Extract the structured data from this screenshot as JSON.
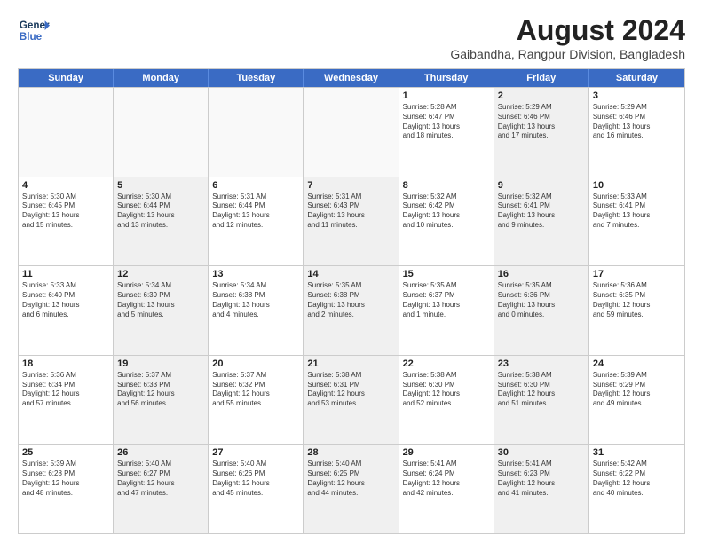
{
  "header": {
    "logo_line1": "General",
    "logo_line2": "Blue",
    "title": "August 2024",
    "subtitle": "Gaibandha, Rangpur Division, Bangladesh"
  },
  "days_of_week": [
    "Sunday",
    "Monday",
    "Tuesday",
    "Wednesday",
    "Thursday",
    "Friday",
    "Saturday"
  ],
  "weeks": [
    [
      {
        "day": "",
        "text": "",
        "shaded": false,
        "empty": true
      },
      {
        "day": "",
        "text": "",
        "shaded": false,
        "empty": true
      },
      {
        "day": "",
        "text": "",
        "shaded": false,
        "empty": true
      },
      {
        "day": "",
        "text": "",
        "shaded": false,
        "empty": true
      },
      {
        "day": "1",
        "text": "Sunrise: 5:28 AM\nSunset: 6:47 PM\nDaylight: 13 hours\nand 18 minutes.",
        "shaded": false,
        "empty": false
      },
      {
        "day": "2",
        "text": "Sunrise: 5:29 AM\nSunset: 6:46 PM\nDaylight: 13 hours\nand 17 minutes.",
        "shaded": true,
        "empty": false
      },
      {
        "day": "3",
        "text": "Sunrise: 5:29 AM\nSunset: 6:46 PM\nDaylight: 13 hours\nand 16 minutes.",
        "shaded": false,
        "empty": false
      }
    ],
    [
      {
        "day": "4",
        "text": "Sunrise: 5:30 AM\nSunset: 6:45 PM\nDaylight: 13 hours\nand 15 minutes.",
        "shaded": false,
        "empty": false
      },
      {
        "day": "5",
        "text": "Sunrise: 5:30 AM\nSunset: 6:44 PM\nDaylight: 13 hours\nand 13 minutes.",
        "shaded": true,
        "empty": false
      },
      {
        "day": "6",
        "text": "Sunrise: 5:31 AM\nSunset: 6:44 PM\nDaylight: 13 hours\nand 12 minutes.",
        "shaded": false,
        "empty": false
      },
      {
        "day": "7",
        "text": "Sunrise: 5:31 AM\nSunset: 6:43 PM\nDaylight: 13 hours\nand 11 minutes.",
        "shaded": true,
        "empty": false
      },
      {
        "day": "8",
        "text": "Sunrise: 5:32 AM\nSunset: 6:42 PM\nDaylight: 13 hours\nand 10 minutes.",
        "shaded": false,
        "empty": false
      },
      {
        "day": "9",
        "text": "Sunrise: 5:32 AM\nSunset: 6:41 PM\nDaylight: 13 hours\nand 9 minutes.",
        "shaded": true,
        "empty": false
      },
      {
        "day": "10",
        "text": "Sunrise: 5:33 AM\nSunset: 6:41 PM\nDaylight: 13 hours\nand 7 minutes.",
        "shaded": false,
        "empty": false
      }
    ],
    [
      {
        "day": "11",
        "text": "Sunrise: 5:33 AM\nSunset: 6:40 PM\nDaylight: 13 hours\nand 6 minutes.",
        "shaded": false,
        "empty": false
      },
      {
        "day": "12",
        "text": "Sunrise: 5:34 AM\nSunset: 6:39 PM\nDaylight: 13 hours\nand 5 minutes.",
        "shaded": true,
        "empty": false
      },
      {
        "day": "13",
        "text": "Sunrise: 5:34 AM\nSunset: 6:38 PM\nDaylight: 13 hours\nand 4 minutes.",
        "shaded": false,
        "empty": false
      },
      {
        "day": "14",
        "text": "Sunrise: 5:35 AM\nSunset: 6:38 PM\nDaylight: 13 hours\nand 2 minutes.",
        "shaded": true,
        "empty": false
      },
      {
        "day": "15",
        "text": "Sunrise: 5:35 AM\nSunset: 6:37 PM\nDaylight: 13 hours\nand 1 minute.",
        "shaded": false,
        "empty": false
      },
      {
        "day": "16",
        "text": "Sunrise: 5:35 AM\nSunset: 6:36 PM\nDaylight: 13 hours\nand 0 minutes.",
        "shaded": true,
        "empty": false
      },
      {
        "day": "17",
        "text": "Sunrise: 5:36 AM\nSunset: 6:35 PM\nDaylight: 12 hours\nand 59 minutes.",
        "shaded": false,
        "empty": false
      }
    ],
    [
      {
        "day": "18",
        "text": "Sunrise: 5:36 AM\nSunset: 6:34 PM\nDaylight: 12 hours\nand 57 minutes.",
        "shaded": false,
        "empty": false
      },
      {
        "day": "19",
        "text": "Sunrise: 5:37 AM\nSunset: 6:33 PM\nDaylight: 12 hours\nand 56 minutes.",
        "shaded": true,
        "empty": false
      },
      {
        "day": "20",
        "text": "Sunrise: 5:37 AM\nSunset: 6:32 PM\nDaylight: 12 hours\nand 55 minutes.",
        "shaded": false,
        "empty": false
      },
      {
        "day": "21",
        "text": "Sunrise: 5:38 AM\nSunset: 6:31 PM\nDaylight: 12 hours\nand 53 minutes.",
        "shaded": true,
        "empty": false
      },
      {
        "day": "22",
        "text": "Sunrise: 5:38 AM\nSunset: 6:30 PM\nDaylight: 12 hours\nand 52 minutes.",
        "shaded": false,
        "empty": false
      },
      {
        "day": "23",
        "text": "Sunrise: 5:38 AM\nSunset: 6:30 PM\nDaylight: 12 hours\nand 51 minutes.",
        "shaded": true,
        "empty": false
      },
      {
        "day": "24",
        "text": "Sunrise: 5:39 AM\nSunset: 6:29 PM\nDaylight: 12 hours\nand 49 minutes.",
        "shaded": false,
        "empty": false
      }
    ],
    [
      {
        "day": "25",
        "text": "Sunrise: 5:39 AM\nSunset: 6:28 PM\nDaylight: 12 hours\nand 48 minutes.",
        "shaded": false,
        "empty": false
      },
      {
        "day": "26",
        "text": "Sunrise: 5:40 AM\nSunset: 6:27 PM\nDaylight: 12 hours\nand 47 minutes.",
        "shaded": true,
        "empty": false
      },
      {
        "day": "27",
        "text": "Sunrise: 5:40 AM\nSunset: 6:26 PM\nDaylight: 12 hours\nand 45 minutes.",
        "shaded": false,
        "empty": false
      },
      {
        "day": "28",
        "text": "Sunrise: 5:40 AM\nSunset: 6:25 PM\nDaylight: 12 hours\nand 44 minutes.",
        "shaded": true,
        "empty": false
      },
      {
        "day": "29",
        "text": "Sunrise: 5:41 AM\nSunset: 6:24 PM\nDaylight: 12 hours\nand 42 minutes.",
        "shaded": false,
        "empty": false
      },
      {
        "day": "30",
        "text": "Sunrise: 5:41 AM\nSunset: 6:23 PM\nDaylight: 12 hours\nand 41 minutes.",
        "shaded": true,
        "empty": false
      },
      {
        "day": "31",
        "text": "Sunrise: 5:42 AM\nSunset: 6:22 PM\nDaylight: 12 hours\nand 40 minutes.",
        "shaded": false,
        "empty": false
      }
    ]
  ]
}
